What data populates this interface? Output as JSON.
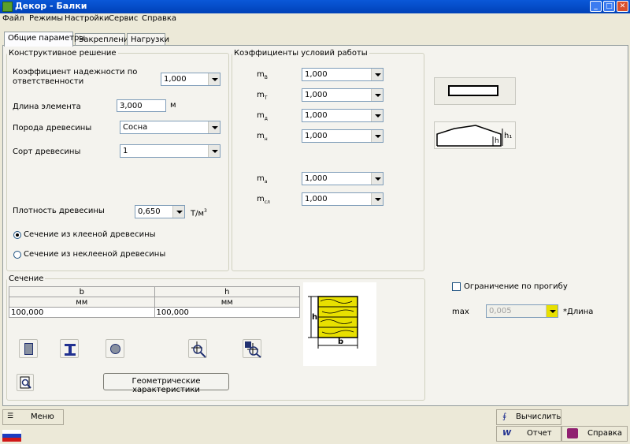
{
  "window": {
    "title": "Декор - Балки",
    "controls": [
      "_",
      "□",
      "✕"
    ]
  },
  "menu": [
    "Файл",
    "Режимы",
    "Настройки",
    "Сервис",
    "Справка"
  ],
  "tabs": [
    "Общие параметры",
    "Закрепление",
    "Нагрузки"
  ],
  "constructive": {
    "legend": "Конструктивное решение",
    "reliability_label_1": "Коэффициент надежности по",
    "reliability_label_2": "ответственности",
    "reliability_value": "1,000",
    "length_label": "Длина элемента",
    "length_value": "3,000",
    "length_unit": "м",
    "species_label": "Порода древесины",
    "species_value": "Сосна",
    "grade_label": "Сорт древесины",
    "grade_value": "1",
    "density_label": "Плотность древесины",
    "density_value": "0,650",
    "density_unit": "Т/м",
    "density_unit_sup": "3",
    "glued_label": "Сечение из клееной древесины",
    "nonglued_label": "Сечение из неклееной древесины",
    "glued_selected": true
  },
  "coefs": {
    "legend": "Коэффициенты условий работы",
    "items": [
      {
        "m": "m",
        "sub": "B",
        "value": "1,000"
      },
      {
        "m": "m",
        "sub": "T",
        "value": "1,000"
      },
      {
        "m": "m",
        "sub": "д",
        "value": "1,000"
      },
      {
        "m": "m",
        "sub": "н",
        "value": "1,000"
      },
      {
        "m": "m",
        "sub": "а",
        "value": "1,000"
      },
      {
        "m": "m",
        "sub": "сл",
        "value": "1,000"
      }
    ]
  },
  "shape_h_label": "h",
  "shape_h1_label": "h₁",
  "section": {
    "legend": "Сечение",
    "col_b": "b",
    "col_h": "h",
    "unit_b": "мм",
    "unit_h": "мм",
    "val_b": "100,000",
    "val_h": "100,000",
    "geom_button": "Геометрические характеристики",
    "diagram_h": "h",
    "diagram_b": "b"
  },
  "deflection": {
    "label": "Ограничение по прогибу",
    "max_label": "max",
    "max_value": "0,005",
    "unit": "*Длина",
    "checked": false
  },
  "bottom": {
    "menu": "Меню",
    "calc": "Вычислить",
    "report": "Отчет",
    "help": "Справка"
  },
  "colors": {
    "accent": "#0a58d8",
    "wood": "#e8e000",
    "panel": "#f4f3ee"
  }
}
